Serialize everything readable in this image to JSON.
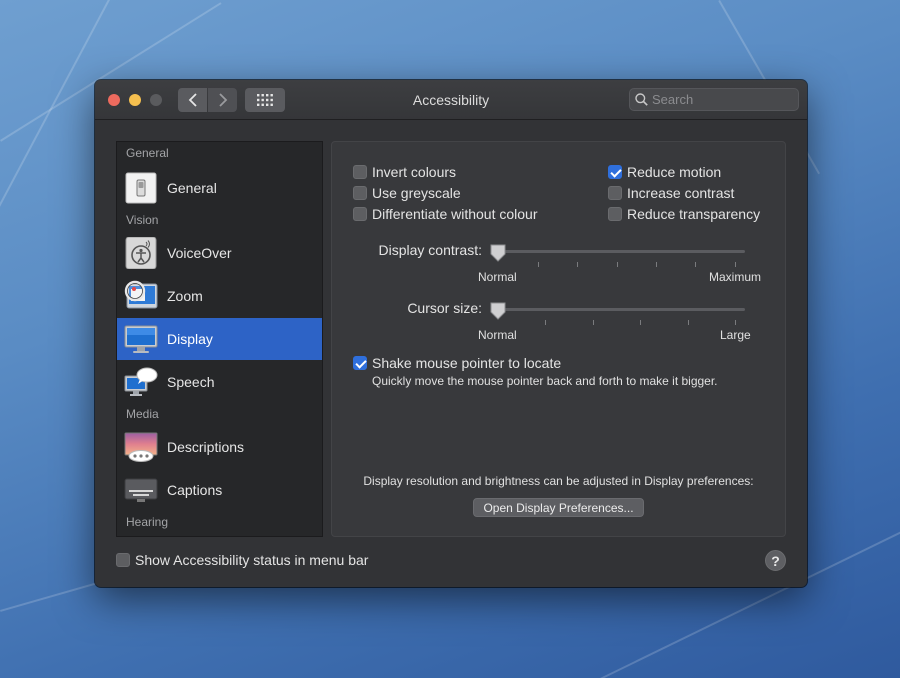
{
  "window": {
    "title": "Accessibility",
    "search": {
      "placeholder": "Search",
      "value": ""
    }
  },
  "sidebar": {
    "sections": [
      {
        "label": "General"
      },
      {
        "label": "Vision"
      },
      {
        "label": "Media"
      },
      {
        "label": "Hearing"
      }
    ],
    "items": [
      {
        "label": "General",
        "icon": "switch-icon"
      },
      {
        "label": "VoiceOver",
        "icon": "voiceover-icon"
      },
      {
        "label": "Zoom",
        "icon": "zoom-icon"
      },
      {
        "label": "Display",
        "icon": "display-icon",
        "selected": true
      },
      {
        "label": "Speech",
        "icon": "speech-icon"
      },
      {
        "label": "Descriptions",
        "icon": "descriptions-icon"
      },
      {
        "label": "Captions",
        "icon": "captions-icon"
      }
    ]
  },
  "display": {
    "checkboxes": {
      "invert_colours": {
        "label": "Invert colours",
        "checked": false
      },
      "use_greyscale": {
        "label": "Use greyscale",
        "checked": false
      },
      "differentiate": {
        "label": "Differentiate without colour",
        "checked": false
      },
      "reduce_motion": {
        "label": "Reduce motion",
        "checked": true
      },
      "increase_contrast": {
        "label": "Increase contrast",
        "checked": false
      },
      "reduce_transparency": {
        "label": "Reduce transparency",
        "checked": false
      }
    },
    "contrast_slider": {
      "label": "Display contrast:",
      "min_label": "Normal",
      "max_label": "Maximum",
      "value": 0
    },
    "cursor_slider": {
      "label": "Cursor size:",
      "min_label": "Normal",
      "max_label": "Large",
      "value": 0
    },
    "shake": {
      "label": "Shake mouse pointer to locate",
      "checked": true,
      "description": "Quickly move the mouse pointer back and forth to make it bigger."
    },
    "resolution_note": "Display resolution and brightness can be adjusted in Display preferences:",
    "open_prefs_button": "Open Display Preferences..."
  },
  "footer": {
    "status_checkbox": {
      "label": "Show Accessibility status in menu bar",
      "checked": false
    },
    "help_label": "?"
  },
  "colors": {
    "accent": "#2f6fdc",
    "selection": "#2d63c6"
  }
}
